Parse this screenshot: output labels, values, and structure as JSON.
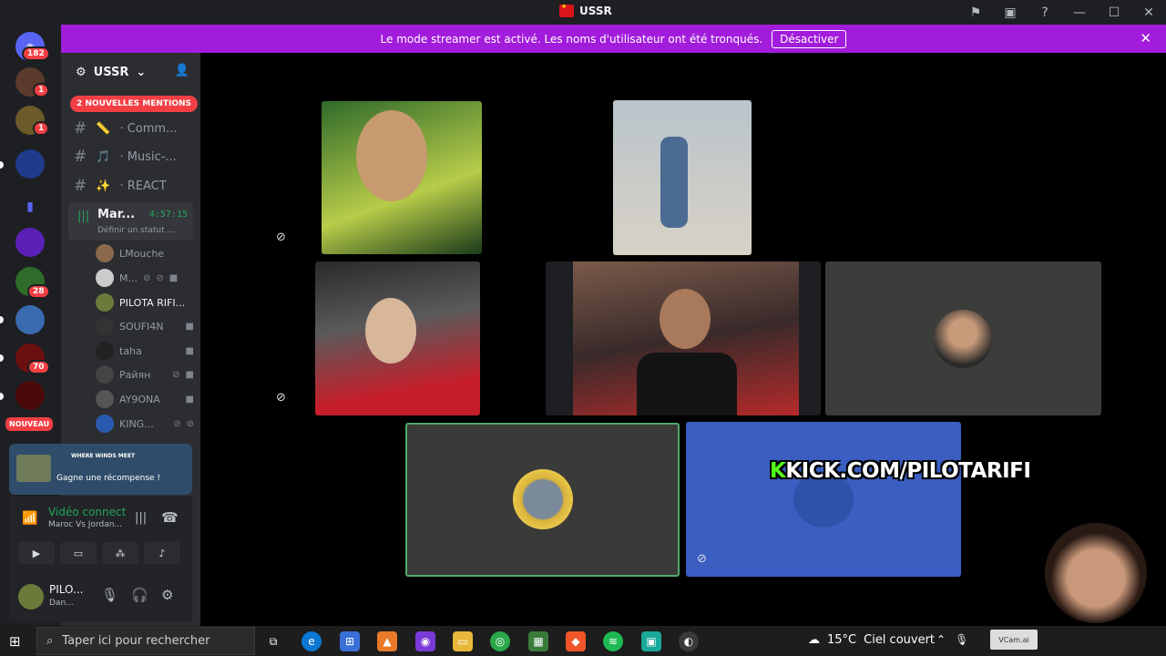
{
  "window": {
    "title": "USSR"
  },
  "banner": {
    "text": "Le mode streamer est activé. Les noms d'utilisateur ont été tronqués.",
    "button": "Désactiver"
  },
  "servers": {
    "dm_badge": "182",
    "badges": [
      "1",
      "1",
      "28",
      "70"
    ],
    "new_label": "NOUVEAU"
  },
  "sidebar": {
    "server_name": "USSR",
    "mentions": "2 NOUVELLES MENTIONS",
    "channels": [
      {
        "emoji": "📏",
        "label": "· Comm..."
      },
      {
        "emoji": "🎵",
        "label": "· Music-..."
      },
      {
        "emoji": "✨",
        "label": "· REACT"
      }
    ],
    "voice_channel": {
      "name": "Mar...",
      "time": "4:57:15",
      "status": "Définir un statut ..."
    },
    "users": [
      "LMouche",
      "M...",
      "PILOTA RIFI...",
      "SOUFI4N",
      "taha",
      "Райян",
      "AY9ONA",
      "KING..."
    ]
  },
  "promo": {
    "game": "WHERE WINDS MEET",
    "text": "Gagne une récompense !"
  },
  "voice_panel": {
    "status": "Vidéo connect",
    "channel": "Maroc Vs Jordan..."
  },
  "user_panel": {
    "name": "PILO...",
    "status": "Dan..."
  },
  "overlay": {
    "kick_k": "K",
    "kick_url": "KICK.COM/PILOTARIFI"
  },
  "taskbar": {
    "search_placeholder": "Taper ici pour rechercher",
    "weather_temp": "15°C",
    "weather_text": "Ciel couvert",
    "vcam": "VCam.ai"
  },
  "colors": {
    "banner": "#a21cdb",
    "speaking_border": "#4fa86a",
    "blue_tile": "#3b5ec2",
    "kick_green": "#53fc18"
  }
}
